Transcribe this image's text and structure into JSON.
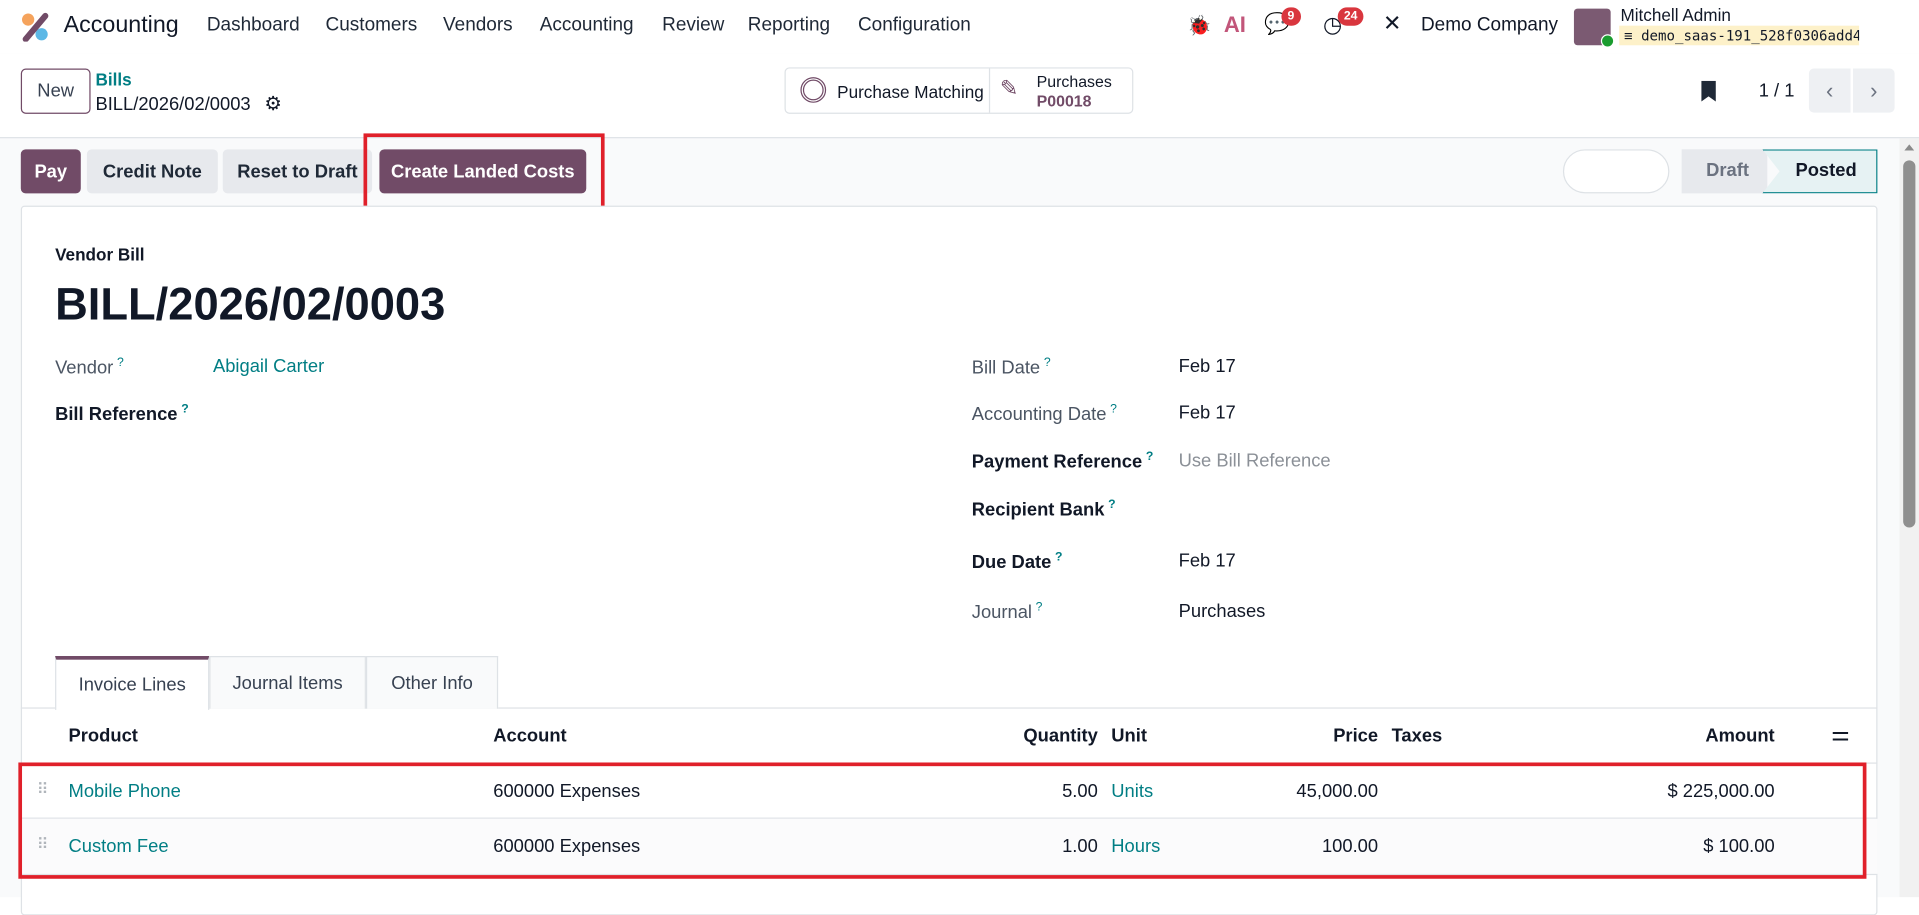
{
  "navbar": {
    "app_name": "Accounting",
    "menu": [
      "Dashboard",
      "Customers",
      "Vendors",
      "Accounting",
      "Review",
      "Reporting",
      "Configuration"
    ],
    "messages_count": "9",
    "activities_count": "24",
    "company": "Demo Company",
    "user": "Mitchell Admin",
    "database": "demo_saas-191_528f0306add4…"
  },
  "control_panel": {
    "new_label": "New",
    "breadcrumb_parent": "Bills",
    "record_name": "BILL/2026/02/0003",
    "purchase_matching": "Purchase Matching",
    "purchases_label": "Purchases",
    "purchases_ref": "P00018",
    "pager": "1 / 1"
  },
  "actions": {
    "pay": "Pay",
    "credit_note": "Credit Note",
    "reset_to_draft": "Reset to Draft",
    "create_landed_costs": "Create Landed Costs"
  },
  "status": {
    "stages": [
      "Draft",
      "Posted"
    ],
    "current": "Posted"
  },
  "form": {
    "type_label": "Vendor Bill",
    "title": "BILL/2026/02/0003",
    "vendor_label": "Vendor",
    "vendor": "Abigail Carter",
    "bill_ref_label": "Bill Reference",
    "bill_date_label": "Bill Date",
    "bill_date": "Feb 17",
    "acc_date_label": "Accounting Date",
    "acc_date": "Feb 17",
    "pay_ref_label": "Payment Reference",
    "pay_ref_placeholder": "Use Bill Reference",
    "bank_label": "Recipient Bank",
    "due_date_label": "Due Date",
    "due_date": "Feb 17",
    "journal_label": "Journal",
    "journal": "Purchases",
    "help_mark": "?"
  },
  "tabs": [
    "Invoice Lines",
    "Journal Items",
    "Other Info"
  ],
  "table": {
    "headers": {
      "product": "Product",
      "account": "Account",
      "quantity": "Quantity",
      "unit": "Unit",
      "price": "Price",
      "taxes": "Taxes",
      "amount": "Amount"
    },
    "rows": [
      {
        "product": "Mobile Phone",
        "account": "600000 Expenses",
        "quantity": "5.00",
        "unit": "Units",
        "price": "45,000.00",
        "taxes": "",
        "amount": "$ 225,000.00"
      },
      {
        "product": "Custom Fee",
        "account": "600000 Expenses",
        "quantity": "1.00",
        "unit": "Hours",
        "price": "100.00",
        "taxes": "",
        "amount": "$ 100.00"
      }
    ]
  },
  "colors": {
    "brand": "#714b67",
    "link": "#017e84",
    "highlight": "#e0202a"
  }
}
